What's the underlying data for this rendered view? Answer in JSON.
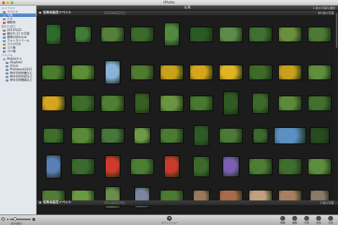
{
  "window": {
    "title": "iPhoto"
  },
  "sidebar": {
    "library_header": "ライブラリ",
    "library_items": [
      {
        "label": "イベント",
        "icon": "events-icon",
        "selected": false
      },
      {
        "label": "写真",
        "icon": "photos-icon",
        "selected": true
      },
      {
        "label": "人々",
        "icon": "faces-icon",
        "selected": false
      },
      {
        "label": "撮影地",
        "icon": "places-icon",
        "selected": false
      }
    ],
    "recent_header": "最近の項目",
    "recent_items": [
      {
        "label": "2013/5/23",
        "icon": "event-icon"
      },
      {
        "label": "最近の 12 か月間",
        "icon": "calendar-icon"
      },
      {
        "label": "最後の読み込み",
        "icon": "import-icon"
      },
      {
        "label": "フォトストリーム",
        "icon": "photostream-icon"
      },
      {
        "label": "フラグ付き",
        "icon": "flag-icon"
      },
      {
        "label": "ゴミ箱",
        "icon": "trash-icon"
      },
      {
        "label": "ゴミ箱",
        "icon": "trash-icon"
      }
    ],
    "albums_header": "アルバム",
    "album_items": [
      {
        "label": "Mobileから",
        "icon": "folder-icon",
        "sub": false
      },
      {
        "label": "iDigitalal",
        "icon": "album-icon",
        "sub": true
      },
      {
        "label": "京太の",
        "icon": "album-icon",
        "sub": true
      },
      {
        "label": "Photobook2012",
        "icon": "album-icon",
        "sub": true
      },
      {
        "label": "毎年学校修養など",
        "icon": "album-icon",
        "sub": true
      },
      {
        "label": "毎年学校合宿など",
        "icon": "album-icon",
        "sub": true
      },
      {
        "label": "毎年学校機器など",
        "icon": "album-icon",
        "sub": true
      }
    ]
  },
  "main": {
    "title": "写真",
    "selection_status": "1 枚の写真を選択",
    "events": [
      {
        "title": "名称未設定イベント",
        "date": "2013年6月22日",
        "count": "66 枚の写真"
      },
      {
        "title": "名称未設定イベント",
        "date": "2013年6月29日",
        "count": "3 枚の写真"
      }
    ]
  },
  "photos": [
    [
      "#2f6b2a",
      "#3f7d36",
      "#55803a",
      "#3a6a2c",
      "#4f8a3e",
      "#2a5a24",
      "#5c8c4a",
      "#3e6f33",
      "#6a8f3d",
      "#4c7a34"
    ],
    [
      "#4a7d2f",
      "#5d8f36",
      "#8ab3d8",
      "#4f7a32",
      "#c9a21a",
      "#d4a51d",
      "#e0b320",
      "#3e6a28",
      "#c8a01b",
      "#5f8f3d"
    ],
    [
      "#d4a51d",
      "#3d6d2a",
      "#4e7f33",
      "#375f25",
      "#6b9440",
      "#477a30",
      "#2f5a22",
      "#3b6a2a",
      "#5b8a3b",
      "#42712f"
    ],
    [
      "#3f6d2c",
      "#5a8a39",
      "#46773a",
      "#6c9a48",
      "#4b7a33",
      "#2e5b25",
      "#4a7a36",
      "#3b6b2c",
      "#5c8fc2",
      "#274a20"
    ],
    [
      "#5a7fb5",
      "#3a6a2d",
      "#d03a2a",
      "#4b7d33",
      "#c73a2c",
      "#3c6a2d",
      "#7a5fb0",
      "#4d7d35",
      "#3e6e2e",
      "#5c8c3d"
    ],
    [
      "#4f7d36",
      "#6a9a42",
      "#6c8c4a",
      "#7a86a0",
      "#4b7a33",
      "#9a7a5a",
      "#a86b4a",
      "#c0a080",
      "#a88060",
      "#8a7a6a"
    ]
  ],
  "toolbar": {
    "zoom_label": "拡大/縮小",
    "zoom_level": 0.15,
    "slideshow_label": "スライドショー",
    "buttons": [
      {
        "label": "情報",
        "icon": "info-icon"
      },
      {
        "label": "編集",
        "icon": "edit-icon"
      },
      {
        "label": "作成",
        "icon": "create-icon"
      },
      {
        "label": "追加",
        "icon": "add-icon"
      },
      {
        "label": "共有",
        "icon": "share-icon"
      }
    ]
  }
}
